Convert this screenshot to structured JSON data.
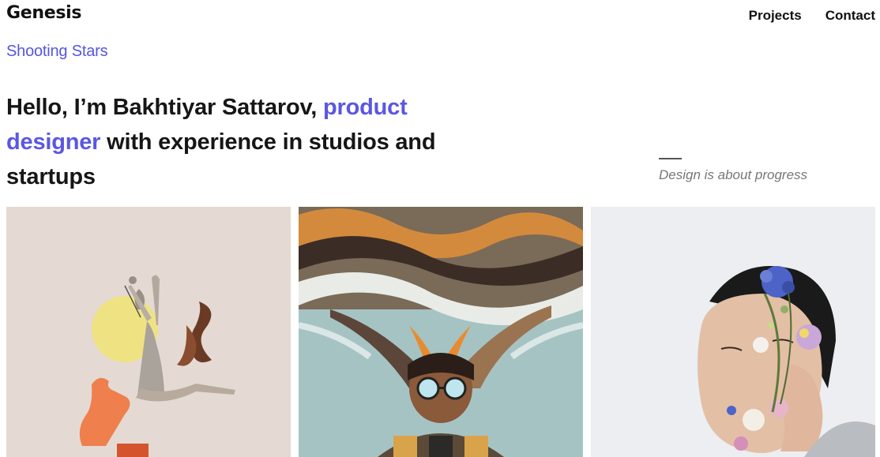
{
  "header": {
    "logo": "Genesis",
    "nav": [
      {
        "label": "Projects"
      },
      {
        "label": "Contact"
      }
    ]
  },
  "intro": {
    "subtitle": "Shooting Stars",
    "headline_part1": "Hello, I’m Bakhtiyar Sattarov, ",
    "headline_accent": "product designer",
    "headline_part2": " with experience in studios and startups",
    "quote": "Design is about progress"
  },
  "colors": {
    "accent": "#5a57e3",
    "text": "#161616",
    "muted": "#777777"
  },
  "gallery": [
    {
      "subject": "dancer collage artwork"
    },
    {
      "subject": "man with exploding colorful hair artwork"
    },
    {
      "subject": "man with flowers on face artwork"
    }
  ]
}
